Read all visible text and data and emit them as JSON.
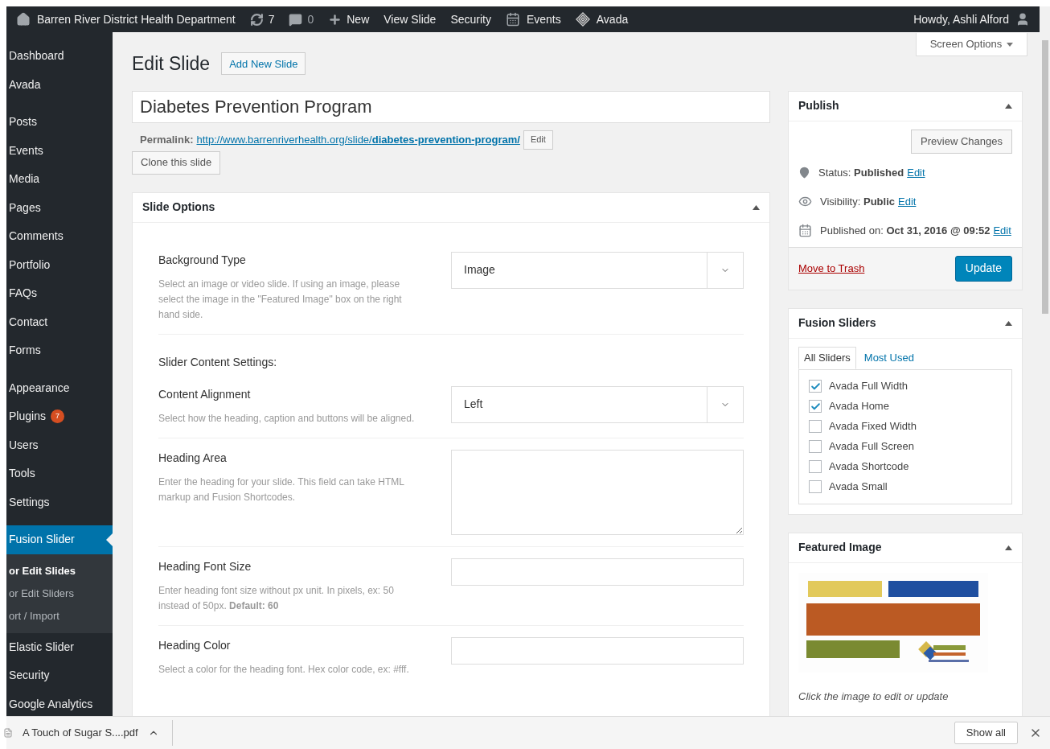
{
  "admin_bar": {
    "site": "Barren River District Health Department",
    "updates": "7",
    "comments": "0",
    "new": "New",
    "links": [
      "View Slide",
      "Security"
    ],
    "events": "Events",
    "avada": "Avada",
    "greeting": "Howdy, Ashli Alford"
  },
  "sidebar": {
    "groups": [
      [
        {
          "label": "Dashboard",
          "selected": false
        },
        {
          "label": "Avada",
          "selected": false
        }
      ],
      [
        {
          "label": "Posts",
          "selected": false
        },
        {
          "label": "Events",
          "selected": false
        },
        {
          "label": "Media",
          "selected": false
        },
        {
          "label": "Pages",
          "selected": false
        },
        {
          "label": "Comments",
          "selected": false
        },
        {
          "label": "Portfolio",
          "selected": false
        },
        {
          "label": "FAQs",
          "selected": false
        },
        {
          "label": "Contact",
          "selected": false
        },
        {
          "label": "Forms",
          "selected": false
        }
      ],
      [
        {
          "label": "Appearance",
          "selected": false
        },
        {
          "label": "Plugins",
          "selected": false,
          "badge": "7"
        },
        {
          "label": "Users",
          "selected": false
        },
        {
          "label": "Tools",
          "selected": false
        },
        {
          "label": "Settings",
          "selected": false
        }
      ],
      [
        {
          "label": "Fusion Slider",
          "selected": true,
          "children": [
            {
              "label": "or Edit Slides",
              "selected": true
            },
            {
              "label": "or Edit Sliders",
              "selected": false
            },
            {
              "label": "ort / Import",
              "selected": false
            }
          ]
        },
        {
          "label": "Elastic Slider",
          "selected": false
        },
        {
          "label": "Security",
          "selected": false
        },
        {
          "label": "Google Analytics",
          "selected": false
        }
      ]
    ]
  },
  "screen_options": "Screen Options",
  "page": {
    "title": "Edit Slide",
    "add_new": "Add New Slide",
    "post_title": "Diabetes Prevention Program",
    "permalink_label": "Permalink:",
    "permalink_base": "http://www.barrenriverhealth.org/slide/",
    "permalink_slug": "diabetes-prevention-program/",
    "permalink_edit": "Edit",
    "clone": "Clone this slide"
  },
  "slide_options": {
    "title": "Slide Options",
    "rows": [
      {
        "label": "Background Type",
        "description": "Select an image or video slide. If using an image, please select the image in the \"Featured Image\" box on the right hand side.",
        "kind": "select",
        "value": "Image"
      },
      {
        "kind": "heading",
        "label": "Slider Content Settings:"
      },
      {
        "label": "Content Alignment",
        "description": "Select how the heading, caption and buttons will be aligned.",
        "kind": "select",
        "value": "Left"
      },
      {
        "label": "Heading Area",
        "description": "Enter the heading for your slide. This field can take HTML markup and Fusion Shortcodes.",
        "kind": "textarea"
      },
      {
        "label": "Heading Font Size",
        "description": "Enter heading font size without px unit. In pixels, ex: 50 instead of 50px. **Default: 60**",
        "kind": "text"
      },
      {
        "label": "Heading Color",
        "description": "Select a color for the heading font. Hex color code, ex: #fff.",
        "kind": "text"
      }
    ]
  },
  "publish": {
    "title": "Publish",
    "preview": "Preview Changes",
    "status_label": "Status:",
    "status": "Published",
    "visibility_label": "Visibility:",
    "visibility": "Public",
    "published_label": "Published on:",
    "published": "Oct 31, 2016 @ 09:52",
    "status_edit": "Edit",
    "visibility_edit": "Edit",
    "published_edit": "Edit",
    "trash": "Move to Trash",
    "update": "Update"
  },
  "fusion_sliders": {
    "title": "Fusion Sliders",
    "tabs": [
      {
        "label": "All Sliders",
        "selected": true
      },
      {
        "label": "Most Used",
        "selected": false
      }
    ],
    "items": [
      {
        "label": "Avada Full Width",
        "checked": true
      },
      {
        "label": "Avada Home",
        "checked": true
      },
      {
        "label": "Avada Fixed Width",
        "checked": false
      },
      {
        "label": "Avada Full Screen",
        "checked": false
      },
      {
        "label": "Avada Shortcode",
        "checked": false
      },
      {
        "label": "Avada Small",
        "checked": false
      }
    ]
  },
  "featured_image": {
    "title": "Featured Image",
    "hint": "Click the image to edit or update"
  },
  "downloads": {
    "file": "A Touch of Sugar S....pdf",
    "show_all": "Show all"
  }
}
